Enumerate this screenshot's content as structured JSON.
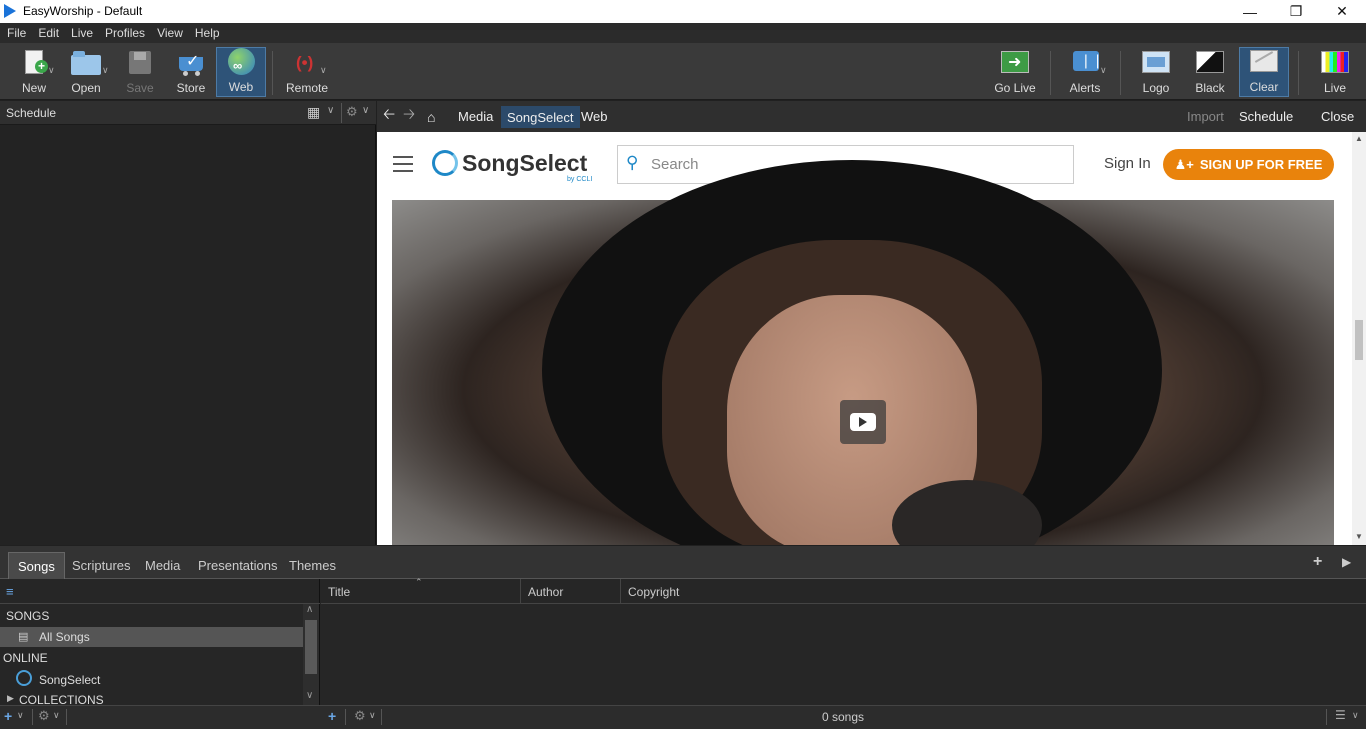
{
  "window": {
    "title": "EasyWorship - Default"
  },
  "menu": [
    "File",
    "Edit",
    "Live",
    "Profiles",
    "View",
    "Help"
  ],
  "toolbar": {
    "new": "New",
    "open": "Open",
    "save": "Save",
    "store": "Store",
    "web": "Web",
    "remote": "Remote",
    "go_live": "Go Live",
    "alerts": "Alerts",
    "logo": "Logo",
    "black": "Black",
    "clear": "Clear",
    "live": "Live"
  },
  "schedule": {
    "title": "Schedule"
  },
  "browser": {
    "tabs": [
      "Media",
      "SongSelect",
      "Web"
    ],
    "active_tab": "SongSelect",
    "import": "Import",
    "schedule": "Schedule",
    "close": "Close"
  },
  "songselect": {
    "logo": "SongSelect",
    "byline": "by CCLI",
    "search_placeholder": "Search",
    "sign_in": "Sign In",
    "signup": "SIGN UP FOR FREE",
    "brand_color": "#e9830c"
  },
  "library": {
    "tabs": [
      "Songs",
      "Scriptures",
      "Media",
      "Presentations",
      "Themes"
    ],
    "active_tab": "Songs",
    "sections": {
      "songs": "SONGS",
      "all_songs": "All Songs",
      "online": "ONLINE",
      "songselect": "SongSelect",
      "collections": "COLLECTIONS"
    },
    "columns": [
      "Title",
      "Author",
      "Copyright"
    ],
    "count": "0 songs"
  }
}
